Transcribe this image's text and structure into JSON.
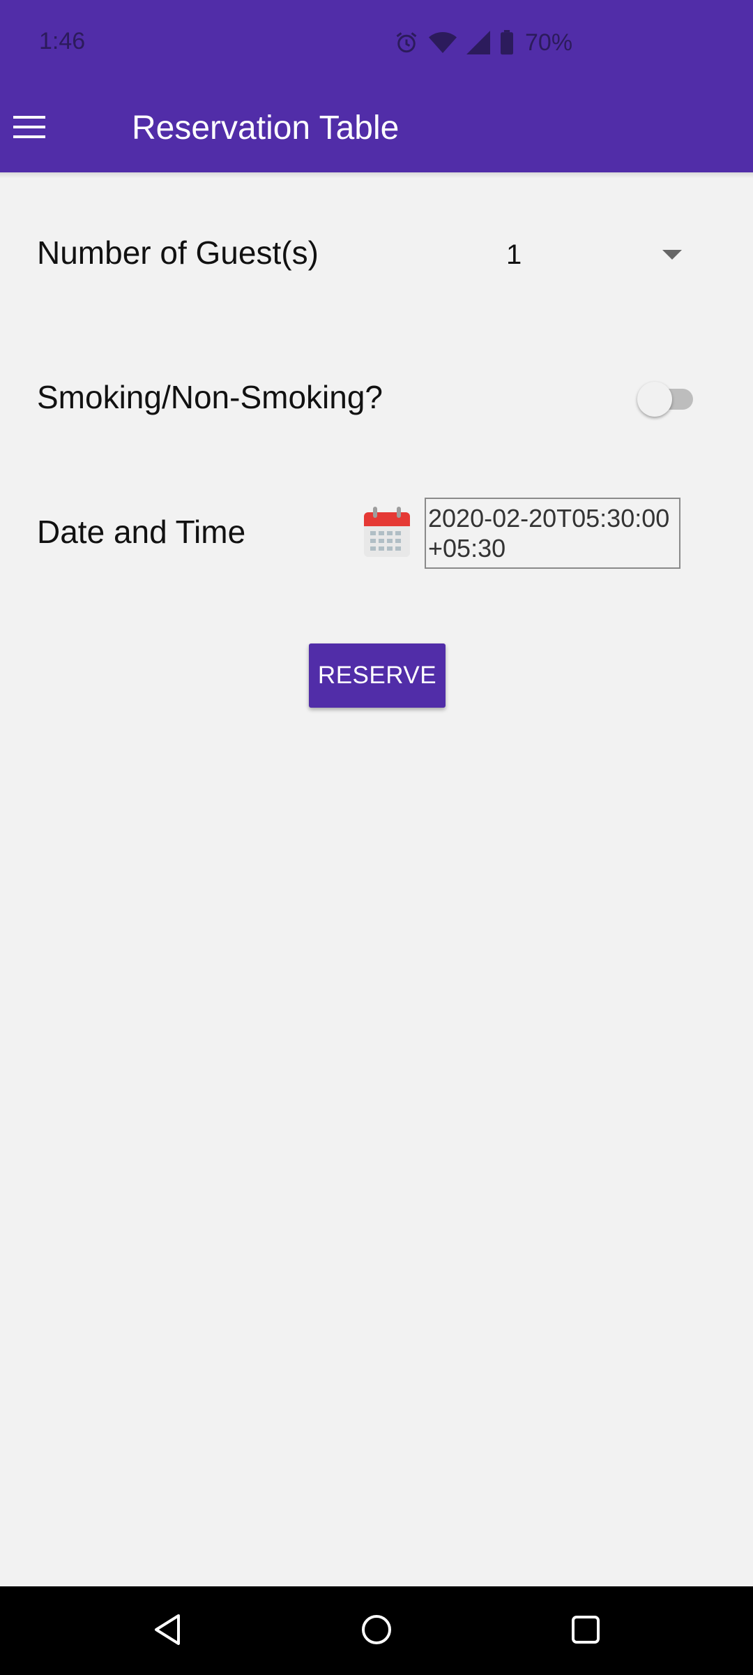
{
  "status_bar": {
    "time": "1:46",
    "battery": "70%",
    "icons": [
      "alarm-icon",
      "wifi-icon",
      "signal-icon",
      "battery-icon"
    ]
  },
  "app_bar": {
    "title": "Reservation Table",
    "menu_icon": "hamburger-menu-icon",
    "color": "#512da8"
  },
  "form": {
    "guests": {
      "label": "Number of Guest(s)",
      "value": "1"
    },
    "smoking": {
      "label": "Smoking/Non-Smoking?",
      "enabled": false
    },
    "datetime": {
      "label": "Date and Time",
      "value": "2020-02-20T05:30:00+05:30",
      "icon": "calendar-icon"
    },
    "reserve_label": "RESERVE"
  },
  "nav_bar": {
    "buttons": [
      "back-icon",
      "home-icon",
      "recents-icon"
    ]
  }
}
